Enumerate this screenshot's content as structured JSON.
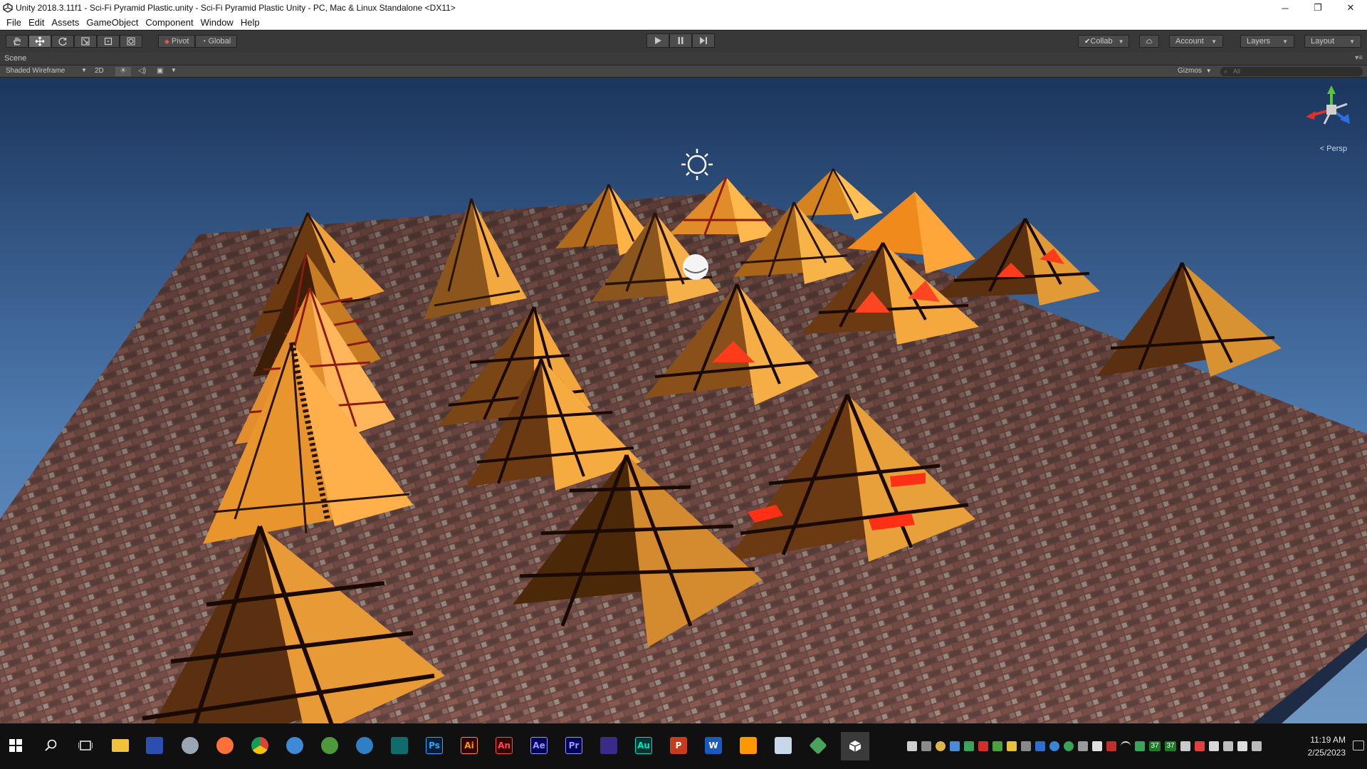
{
  "window": {
    "title": "Unity 2018.3.11f1 - Sci-Fi Pyramid Plastic.unity - Sci-Fi Pyramid Plastic Unity - PC, Mac & Linux Standalone <DX11>",
    "minimize": "─",
    "restore": "❐",
    "close": "✕"
  },
  "menu": [
    "File",
    "Edit",
    "Assets",
    "GameObject",
    "Component",
    "Window",
    "Help"
  ],
  "toolbar": {
    "pivot_label": "Pivot",
    "global_label": "Global",
    "collab_label": "Collab",
    "account_label": "Account",
    "layers_label": "Layers",
    "layout_label": "Layout"
  },
  "scene": {
    "tab_label": "Scene",
    "draw_mode": "Shaded Wireframe",
    "mode_2d": "2D",
    "gizmos_label": "Gizmos",
    "search_placeholder": "All",
    "persp_label": "< Persp"
  },
  "taskbar": {
    "apps": [
      {
        "name": "Photoshop",
        "label": "Ps",
        "color": "#31a8ff",
        "bg": "#001e36"
      },
      {
        "name": "Illustrator",
        "label": "Ai",
        "color": "#ff9a00",
        "bg": "#330000"
      },
      {
        "name": "Animate",
        "label": "An",
        "color": "#ff4b4b",
        "bg": "#330000"
      },
      {
        "name": "After Effects",
        "label": "Ae",
        "color": "#9999ff",
        "bg": "#00005b"
      },
      {
        "name": "Premiere",
        "label": "Pr",
        "color": "#9999ff",
        "bg": "#00005b"
      },
      {
        "name": "Audition",
        "label": "Au",
        "color": "#00e4bb",
        "bg": "#003333"
      }
    ],
    "tray_numbers": [
      "37",
      "37"
    ],
    "time": "11:19 AM",
    "date": "2/25/2023"
  },
  "colors": {
    "toolbar_bg": "#383838",
    "sky_top": "#1b355d",
    "sky_bottom": "#4f7cb1",
    "pyramid_gold": "#f2a53c",
    "pyramid_red": "#ff3b1a",
    "floor_brick": "#6b4a44"
  }
}
